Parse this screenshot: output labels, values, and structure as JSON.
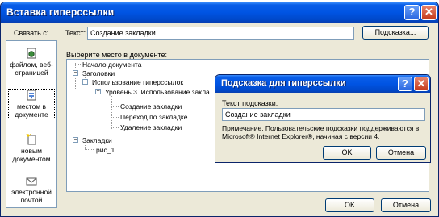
{
  "main_dialog": {
    "title": "Вставка гиперссылки",
    "help_glyph": "?",
    "close_glyph": "✕",
    "link_with_label": "Связать с:",
    "text_label": "Текст:",
    "text_value": "Создание закладки",
    "hint_button": "Подсказка...",
    "choose_label": "Выберите место в документе:",
    "ok_button": "OK",
    "cancel_button": "Отмена"
  },
  "link_types": [
    {
      "label": "файлом, веб-страницей",
      "icon": "globe-page-icon"
    },
    {
      "label": "местом в документе",
      "icon": "document-place-icon"
    },
    {
      "label": "новым документом",
      "icon": "new-document-icon"
    },
    {
      "label": "электронной почтой",
      "icon": "email-icon"
    }
  ],
  "tree": {
    "top": "Начало документа",
    "headings": "Заголовки",
    "use_hyperlinks": "Использование гиперссылок",
    "level3": "Уровень 3. Использование закла",
    "create_bookmark": "Создание закладки",
    "go_to_bookmark": "Переход по закладке",
    "delete_bookmarks": "Удаление закладки",
    "bookmarks": "Закладки",
    "fig1": "рис_1",
    "collapse_glyph": "−"
  },
  "hint_dialog": {
    "title": "Подсказка для гиперссылки",
    "help_glyph": "?",
    "close_glyph": "✕",
    "hint_label": "Текст подсказки:",
    "hint_value": "Создание закладки",
    "note": "Примечание. Пользовательские подсказки поддерживаются в Microsoft® Internet Explorer®, начиная с версии 4.",
    "ok_button": "OK",
    "cancel_button": "Отмена"
  }
}
